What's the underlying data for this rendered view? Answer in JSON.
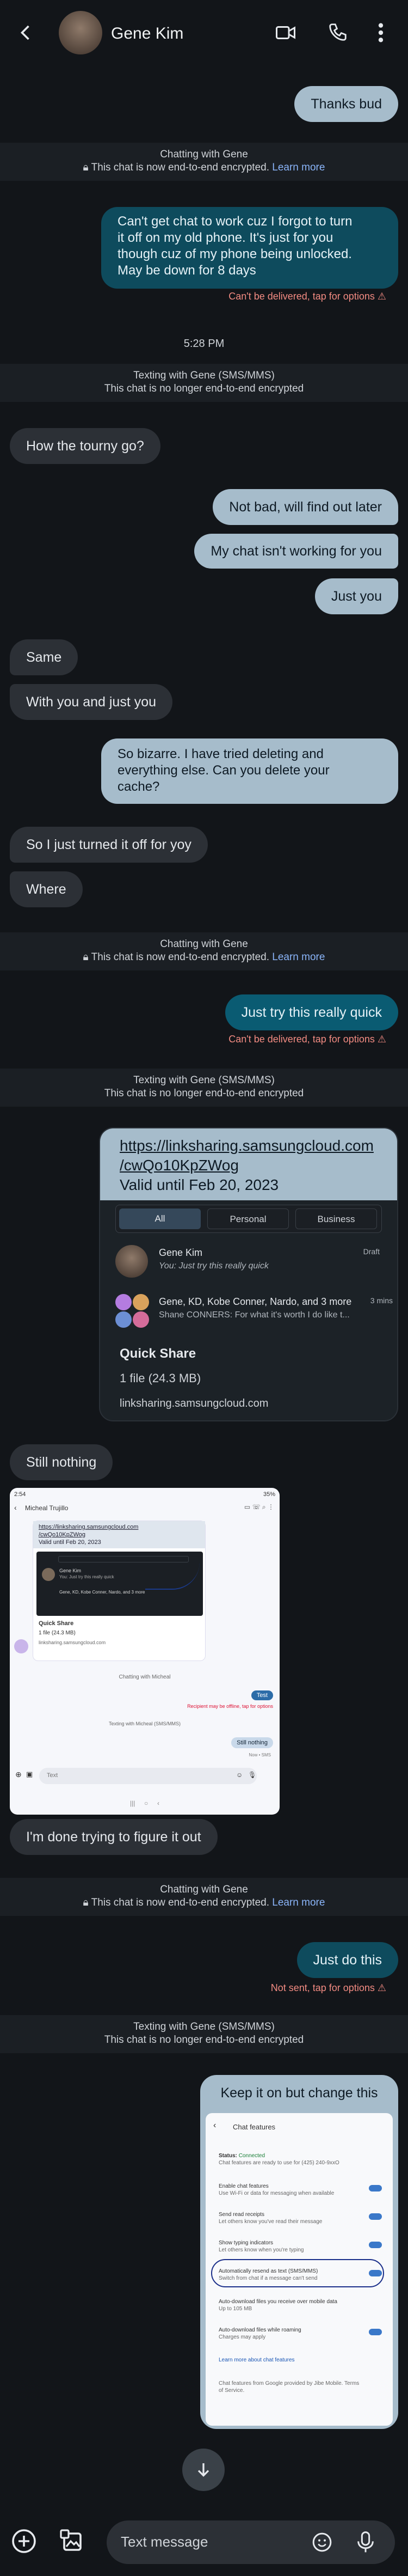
{
  "header": {
    "contact_name": "Gene Kim",
    "back": "back-arrow-icon",
    "video": "video-call-icon",
    "phone": "phone-call-icon",
    "more": "more-vert-icon"
  },
  "sys": {
    "chat_title": "Chatting with Gene",
    "chat_encrypted": "This chat is now end-to-end encrypted.",
    "learn_more": "Learn more",
    "sms_title": "Texting with Gene (SMS/MMS)",
    "sms_not_encrypted": "This chat is no longer end-to-end encrypted"
  },
  "messages": {
    "m1": "Thanks bud",
    "m2_l1": "Can't get chat to work cuz I forgot to turn",
    "m2_l2": "it off on my old phone. It's just for you",
    "m2_l3": "though cuz of my phone being unlocked.",
    "m2_l4": "May be down for 8 days",
    "err1": "Can't be delivered, tap for options",
    "time1": "5:28 PM",
    "m3": "How the tourny go?",
    "m4": "Not bad, will find out later",
    "m5": "My chat isn't working for you",
    "m6": "Just you",
    "m7": "Same",
    "m8": "With you and just you",
    "m9_l1": "So bizarre. I have tried deleting and",
    "m9_l2": "everything else. Can you delete your",
    "m9_l3": "cache?",
    "m10": "So I just turned it off for yoy",
    "m11": "Where",
    "m12": "Just try this really quick",
    "err2": "Can't be delivered, tap for options",
    "m13": "Still nothing",
    "m14": "I'm done trying to figure it out",
    "m15": "Just do this",
    "err3": "Not sent, tap for options",
    "m16": "Keep it on but change this"
  },
  "link_card": {
    "url_l1": "https://linksharing.samsungcloud.com",
    "url_l2": "/cwQo10KpZWog",
    "valid": "Valid until Feb 20, 2023",
    "tab_all": "All",
    "tab_personal": "Personal",
    "tab_business": "Business",
    "row1_name": "Gene Kim",
    "row1_text": "You: Just try this really quick",
    "row1_time": "Draft",
    "row2_name": "Gene, KD, Kobe Conner, Nardo, and 3 more",
    "row2_text": "Shane CONNERS: For what it's worth I do like t...",
    "row2_time": "3 mins",
    "qs_title": "Quick Share",
    "qs_size": "1 file (24.3 MB)",
    "qs_domain": "linksharing.samsungcloud.com"
  },
  "shot1": {
    "status_time": "2:54",
    "status_battery": "35%",
    "contact": "Micheal Trujillo",
    "url_l1": "https://linksharing.samsungcloud.com",
    "url_l2": "/cwQo10KpZWog",
    "valid": "Valid until Feb 20, 2023",
    "inner_row1": "Gene Kim",
    "inner_row1_text": "You: Just try this really quick",
    "inner_row2": "Gene, KD, Kobe Conner, Nardo, and 3 more",
    "qs_title": "Quick Share",
    "qs_size": "1 file (24.3 MB)",
    "qs_domain": "linksharing.samsungcloud.com",
    "chatting": "Chatting with Micheal",
    "test": "Test",
    "recipient_offline": "Recipient may be offline, tap for options",
    "texting": "Texting with Micheal (SMS/MMS)",
    "still_nothing": "Still nothing",
    "now_sms": "Now • SMS",
    "input_ph": "Text"
  },
  "shot2": {
    "title": "Chat features",
    "status_label": "Status:",
    "status_value": "Connected",
    "status_sub": "Chat features are ready to use for (425) 240-9xxO",
    "s1_title": "Enable chat features",
    "s1_sub": "Use Wi-Fi or data for messaging when available",
    "s2_title": "Send read receipts",
    "s2_sub": "Let others know you've read their message",
    "s3_title": "Show typing indicators",
    "s3_sub": "Let others know when you're typing",
    "s4_title": "Automatically resend as text (SMS/MMS)",
    "s4_sub": "Switch from chat if a message can't send",
    "s5_title": "Auto-download files you receive over mobile data",
    "s5_sub": "Up to 105 MB",
    "s6_title": "Auto-download files while roaming",
    "s6_sub": "Charges may apply",
    "learn": "Learn more about chat features",
    "footer_l1": "Chat features from Google provided by Jibe Mobile. Terms",
    "footer_l2": "of Service."
  },
  "composer": {
    "placeholder": "Text message",
    "add": "add-circle-icon",
    "gallery": "gallery-icon",
    "emoji": "emoji-icon",
    "mic": "mic-icon",
    "scroll": "scroll-down-icon"
  },
  "colors": {
    "background": "#121519",
    "incoming": "#2c3036",
    "outgoing_sms": "#a6bccb",
    "outgoing_rcs": "#0e4b5d",
    "error": "#f28b82",
    "link": "#8ab4f8"
  }
}
